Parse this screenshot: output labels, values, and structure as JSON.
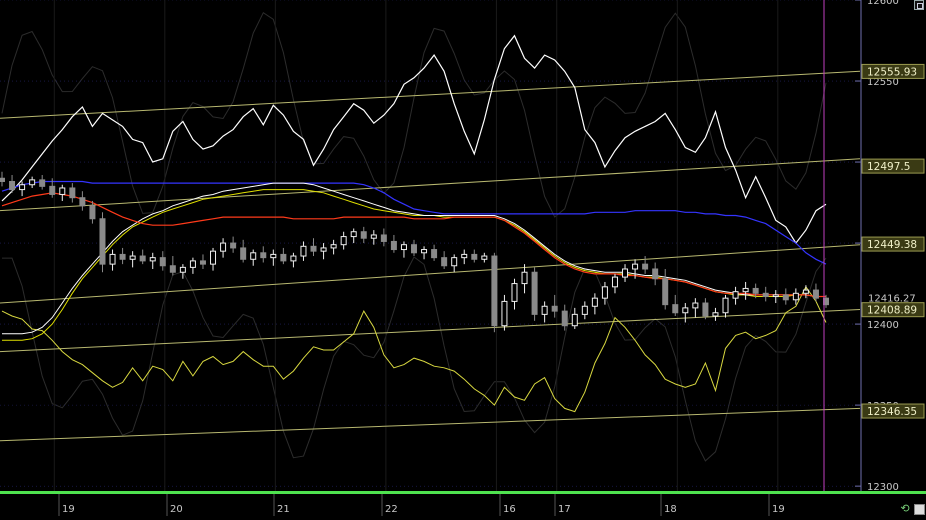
{
  "colors": {
    "background": "#000000",
    "grid": "#24246a",
    "axis_text": "#c8c8c8",
    "channel": "#b8b870",
    "label_box": "#3a3a14",
    "label_text": "#f0f0c8",
    "upper_band": "#ffffff",
    "lower_band": "#d8d840",
    "ma_blue": "#3434ff",
    "ma_red": "#ff3a1a",
    "ma_white": "#ffffff",
    "ma_yellow": "#e0e000",
    "candle_up": "#f0f0f0",
    "candle_down": "#8a8a8a",
    "time_marker": "#c040c0",
    "bottom_bar": "#4fe24f"
  },
  "chart_data": {
    "type": "candlestick",
    "yaxis_ticks": [
      "12600",
      "12550",
      "12500",
      "12450",
      "12400",
      "12350",
      "12300"
    ],
    "ylim": [
      12297,
      12600
    ],
    "xaxis_labels": [
      "19",
      "20",
      "21",
      "22",
      "16",
      "17",
      "18",
      "19"
    ],
    "price_labels": [
      {
        "text": "12555.93",
        "value": 12555.93
      },
      {
        "text": "12497.5",
        "value": 12497.5
      },
      {
        "text": "12449.38",
        "value": 12449.38
      },
      {
        "text": "12416.27",
        "value": 12416.27,
        "style": "plain"
      },
      {
        "text": "12408.89",
        "value": 12408.89
      },
      {
        "text": "12346.35",
        "value": 12346.35
      }
    ],
    "channel_lines": [
      [
        12527,
        12556
      ],
      [
        12470,
        12502
      ],
      [
        12413,
        12449
      ],
      [
        12383,
        12409
      ],
      [
        12328,
        12348
      ]
    ],
    "candles": [
      [
        12490,
        12494,
        12485,
        12488
      ],
      [
        12488,
        12492,
        12481,
        12483
      ],
      [
        12483,
        12488,
        12479,
        12486
      ],
      [
        12486,
        12491,
        12484,
        12489
      ],
      [
        12489,
        12492,
        12483,
        12485
      ],
      [
        12485,
        12490,
        12478,
        12480
      ],
      [
        12480,
        12486,
        12476,
        12484
      ],
      [
        12484,
        12487,
        12475,
        12478
      ],
      [
        12478,
        12482,
        12470,
        12473
      ],
      [
        12473,
        12476,
        12462,
        12465
      ],
      [
        12465,
        12469,
        12432,
        12437
      ],
      [
        12437,
        12446,
        12433,
        12443
      ],
      [
        12443,
        12447,
        12437,
        12440
      ],
      [
        12440,
        12445,
        12435,
        12442
      ],
      [
        12442,
        12446,
        12437,
        12439
      ],
      [
        12439,
        12444,
        12434,
        12441
      ],
      [
        12441,
        12445,
        12433,
        12436
      ],
      [
        12436,
        12442,
        12430,
        12432
      ],
      [
        12432,
        12437,
        12428,
        12435
      ],
      [
        12435,
        12441,
        12431,
        12439
      ],
      [
        12439,
        12443,
        12434,
        12437
      ],
      [
        12437,
        12447,
        12433,
        12445
      ],
      [
        12445,
        12453,
        12441,
        12450
      ],
      [
        12450,
        12454,
        12444,
        12447
      ],
      [
        12447,
        12452,
        12438,
        12440
      ],
      [
        12440,
        12446,
        12436,
        12444
      ],
      [
        12444,
        12448,
        12438,
        12441
      ],
      [
        12441,
        12446,
        12436,
        12443
      ],
      [
        12443,
        12447,
        12437,
        12439
      ],
      [
        12439,
        12444,
        12435,
        12442
      ],
      [
        12442,
        12451,
        12439,
        12448
      ],
      [
        12448,
        12453,
        12442,
        12445
      ],
      [
        12445,
        12450,
        12440,
        12447
      ],
      [
        12447,
        12452,
        12443,
        12449
      ],
      [
        12449,
        12457,
        12446,
        12454
      ],
      [
        12454,
        12459,
        12450,
        12457
      ],
      [
        12457,
        12460,
        12450,
        12453
      ],
      [
        12453,
        12458,
        12449,
        12455
      ],
      [
        12455,
        12459,
        12448,
        12451
      ],
      [
        12451,
        12455,
        12444,
        12446
      ],
      [
        12446,
        12451,
        12441,
        12449
      ],
      [
        12449,
        12452,
        12442,
        12444
      ],
      [
        12444,
        12448,
        12440,
        12446
      ],
      [
        12446,
        12449,
        12439,
        12441
      ],
      [
        12441,
        12445,
        12434,
        12436
      ],
      [
        12436,
        12443,
        12432,
        12441
      ],
      [
        12441,
        12446,
        12437,
        12443
      ],
      [
        12443,
        12446,
        12438,
        12440
      ],
      [
        12440,
        12444,
        12438,
        12442
      ],
      [
        12442,
        12444,
        12395,
        12399
      ],
      [
        12399,
        12418,
        12396,
        12414
      ],
      [
        12414,
        12428,
        12409,
        12425
      ],
      [
        12425,
        12437,
        12419,
        12432
      ],
      [
        12432,
        12435,
        12402,
        12406
      ],
      [
        12406,
        12414,
        12401,
        12411
      ],
      [
        12411,
        12418,
        12404,
        12408
      ],
      [
        12408,
        12412,
        12396,
        12399
      ],
      [
        12399,
        12410,
        12397,
        12406
      ],
      [
        12406,
        12414,
        12403,
        12411
      ],
      [
        12411,
        12419,
        12406,
        12416
      ],
      [
        12416,
        12426,
        12412,
        12423
      ],
      [
        12423,
        12431,
        12419,
        12429
      ],
      [
        12429,
        12437,
        12426,
        12434
      ],
      [
        12434,
        12440,
        12428,
        12437
      ],
      [
        12437,
        12442,
        12431,
        12434
      ],
      [
        12434,
        12438,
        12424,
        12428
      ],
      [
        12428,
        12434,
        12409,
        12412
      ],
      [
        12412,
        12418,
        12405,
        12407
      ],
      [
        12407,
        12413,
        12401,
        12410
      ],
      [
        12410,
        12416,
        12404,
        12413
      ],
      [
        12413,
        12416,
        12403,
        12405
      ],
      [
        12405,
        12410,
        12402,
        12407
      ],
      [
        12407,
        12418,
        12404,
        12416
      ],
      [
        12416,
        12423,
        12412,
        12420
      ],
      [
        12420,
        12426,
        12415,
        12422
      ],
      [
        12422,
        12425,
        12416,
        12419
      ],
      [
        12419,
        12423,
        12414,
        12417
      ],
      [
        12417,
        12421,
        12413,
        12418
      ],
      [
        12418,
        12422,
        12412,
        12415
      ],
      [
        12415,
        12422,
        12412,
        12419
      ],
      [
        12419,
        12424,
        12416,
        12421
      ],
      [
        12421,
        12425,
        12414,
        12416
      ],
      [
        12416,
        12418,
        12410,
        12412
      ]
    ],
    "upper_band": [
      12476,
      12482,
      12489,
      12497,
      12505,
      12513,
      12520,
      12528,
      12534,
      12522,
      12530,
      12526,
      12522,
      12514,
      12512,
      12500,
      12502,
      12519,
      12525,
      12514,
      12508,
      12510,
      12516,
      12520,
      12528,
      12533,
      12523,
      12535,
      12529,
      12519,
      12514,
      12498,
      12508,
      12520,
      12528,
      12536,
      12532,
      12524,
      12529,
      12536,
      12548,
      12552,
      12558,
      12566,
      12556,
      12536,
      12519,
      12505,
      12526,
      12551,
      12570,
      12578,
      12564,
      12558,
      12566,
      12563,
      12556,
      12546,
      12520,
      12512,
      12497,
      12507,
      12515,
      12519,
      12522,
      12525,
      12530,
      12520,
      12509,
      12506,
      12515,
      12531,
      12509,
      12495,
      12478,
      12491,
      12478,
      12464,
      12460,
      12450,
      12458,
      12470,
      12474
    ],
    "lower_band": [
      12408,
      12405,
      12403,
      12397,
      12396,
      12390,
      12383,
      12378,
      12375,
      12370,
      12365,
      12361,
      12364,
      12373,
      12365,
      12374,
      12372,
      12365,
      12377,
      12368,
      12377,
      12380,
      12375,
      12377,
      12383,
      12378,
      12374,
      12374,
      12366,
      12371,
      12379,
      12386,
      12384,
      12384,
      12389,
      12394,
      12408,
      12398,
      12381,
      12373,
      12375,
      12379,
      12377,
      12374,
      12373,
      12371,
      12366,
      12360,
      12356,
      12350,
      12361,
      12355,
      12353,
      12363,
      12367,
      12354,
      12348,
      12346,
      12358,
      12376,
      12388,
      12404,
      12398,
      12390,
      12381,
      12375,
      12366,
      12363,
      12361,
      12363,
      12376,
      12359,
      12385,
      12393,
      12395,
      12391,
      12393,
      12396,
      12407,
      12411,
      12423,
      12414,
      12401
    ],
    "ma_blue": [
      12482,
      12484,
      12486,
      12487,
      12488,
      12488,
      12488,
      12488,
      12488,
      12487,
      12487,
      12487,
      12487,
      12487,
      12487,
      12487,
      12487,
      12487,
      12487,
      12487,
      12487,
      12487,
      12487,
      12487,
      12487,
      12487,
      12487,
      12487,
      12487,
      12487,
      12487,
      12487,
      12487,
      12487,
      12487,
      12487,
      12486,
      12484,
      12481,
      12477,
      12474,
      12471,
      12470,
      12469,
      12468,
      12468,
      12468,
      12468,
      12468,
      12468,
      12468,
      12468,
      12468,
      12468,
      12468,
      12468,
      12468,
      12468,
      12468,
      12469,
      12469,
      12469,
      12469,
      12470,
      12470,
      12470,
      12470,
      12470,
      12469,
      12469,
      12468,
      12468,
      12467,
      12467,
      12466,
      12464,
      12462,
      12458,
      12454,
      12450,
      12444,
      12440,
      12437
    ],
    "ma_red": [
      12473,
      12475,
      12477,
      12479,
      12480,
      12481,
      12480,
      12479,
      12477,
      12475,
      12472,
      12469,
      12466,
      12464,
      12462,
      12461,
      12461,
      12461,
      12462,
      12463,
      12464,
      12465,
      12466,
      12466,
      12466,
      12466,
      12466,
      12466,
      12466,
      12465,
      12465,
      12465,
      12465,
      12465,
      12466,
      12466,
      12466,
      12466,
      12466,
      12466,
      12466,
      12465,
      12465,
      12465,
      12465,
      12466,
      12466,
      12466,
      12466,
      12466,
      12464,
      12460,
      12456,
      12451,
      12446,
      12441,
      12437,
      12434,
      12432,
      12431,
      12431,
      12431,
      12430,
      12430,
      12429,
      12428,
      12428,
      12427,
      12426,
      12424,
      12422,
      12420,
      12419,
      12419,
      12419,
      12418,
      12418,
      12418,
      12418,
      12418,
      12418,
      12417,
      12417
    ],
    "ma_white": [
      12394,
      12394,
      12394,
      12395,
      12398,
      12404,
      12413,
      12422,
      12430,
      12437,
      12444,
      12451,
      12457,
      12461,
      12465,
      12468,
      12470,
      12473,
      12475,
      12477,
      12479,
      12480,
      12482,
      12483,
      12484,
      12485,
      12486,
      12487,
      12487,
      12487,
      12487,
      12486,
      12484,
      12482,
      12480,
      12478,
      12476,
      12474,
      12472,
      12470,
      12469,
      12468,
      12467,
      12467,
      12467,
      12467,
      12467,
      12467,
      12467,
      12467,
      12465,
      12462,
      12458,
      12453,
      12448,
      12443,
      12439,
      12436,
      12434,
      12433,
      12432,
      12432,
      12432,
      12431,
      12430,
      12430,
      12429,
      12428,
      12427,
      12425,
      12423,
      12421,
      12420,
      12419,
      12418,
      12418,
      12418,
      12418,
      12418,
      12418,
      12418,
      12417,
      12417
    ],
    "ma_yellow": [
      12390,
      12390,
      12390,
      12391,
      12394,
      12400,
      12409,
      12419,
      12428,
      12435,
      12442,
      12449,
      12455,
      12460,
      12463,
      12466,
      12469,
      12471,
      12473,
      12475,
      12477,
      12478,
      12479,
      12480,
      12481,
      12482,
      12483,
      12483,
      12483,
      12483,
      12483,
      12482,
      12481,
      12479,
      12477,
      12475,
      12473,
      12471,
      12470,
      12469,
      12468,
      12467,
      12467,
      12467,
      12466,
      12466,
      12466,
      12466,
      12466,
      12466,
      12464,
      12461,
      12457,
      12452,
      12447,
      12442,
      12438,
      12435,
      12433,
      12432,
      12431,
      12431,
      12431,
      12430,
      12429,
      12429,
      12428,
      12427,
      12426,
      12424,
      12422,
      12420,
      12419,
      12418,
      12418,
      12417,
      12417,
      12417,
      12417,
      12418,
      12418,
      12417,
      12417
    ]
  }
}
